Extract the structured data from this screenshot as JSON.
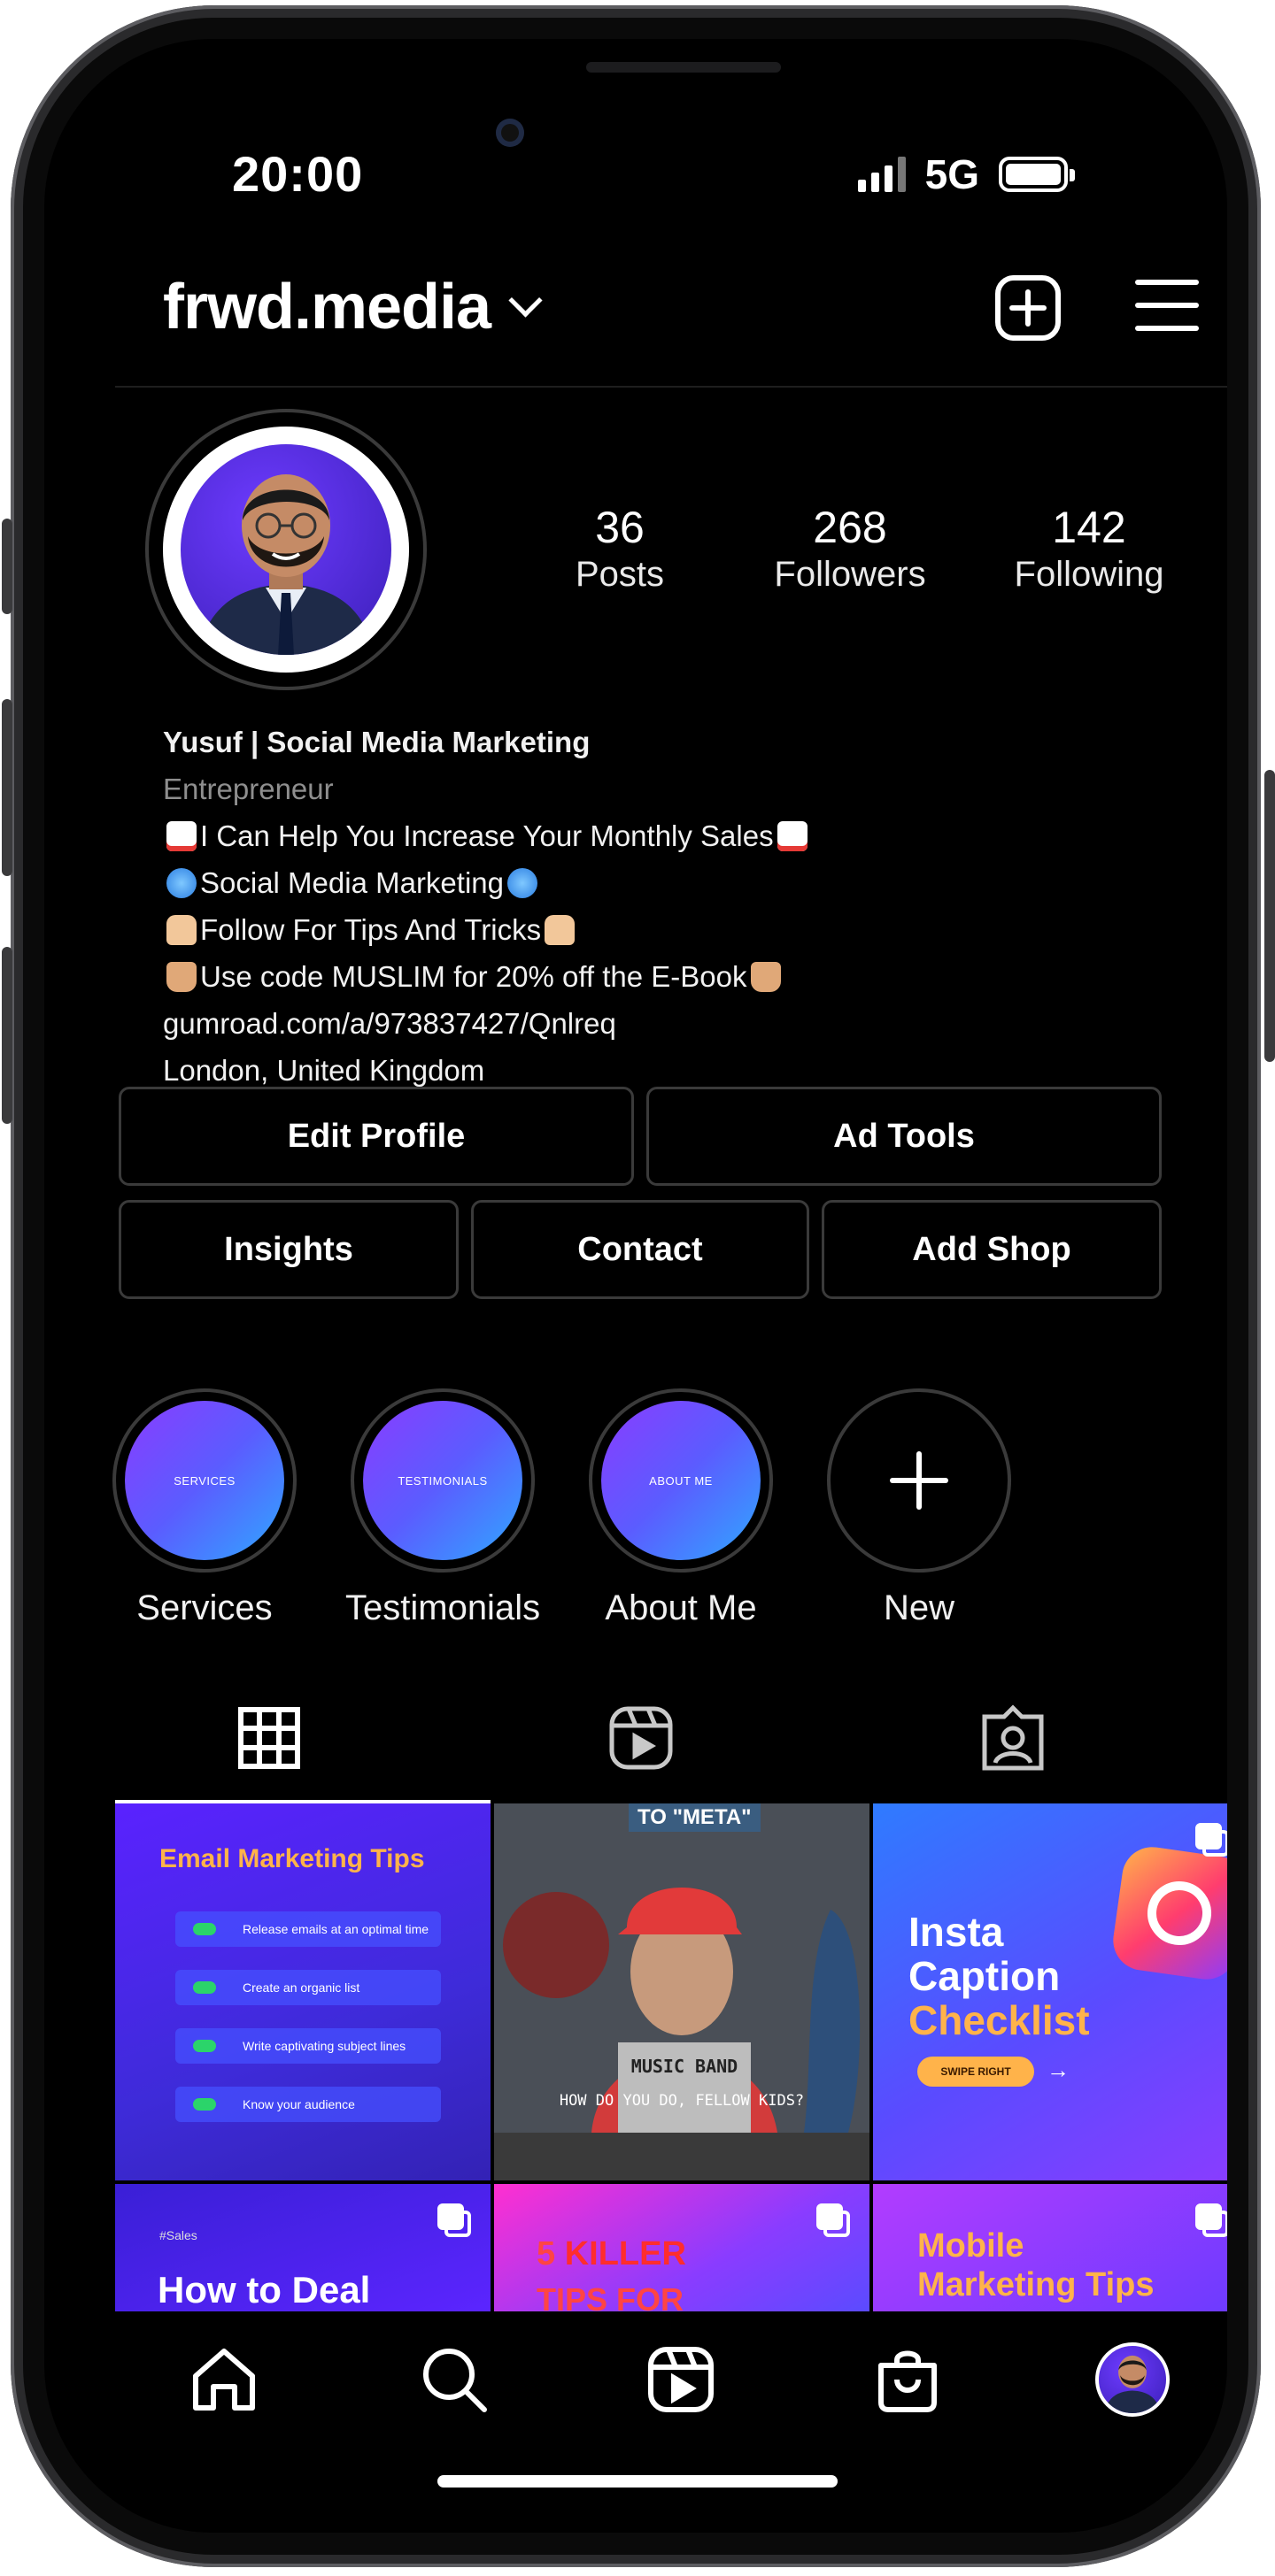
{
  "status_bar": {
    "time": "20:00",
    "network": "5G"
  },
  "header": {
    "username": "frwd.media"
  },
  "profile": {
    "stats": [
      {
        "value": "36",
        "label": "Posts"
      },
      {
        "value": "268",
        "label": "Followers"
      },
      {
        "value": "142",
        "label": "Following"
      }
    ],
    "bio": {
      "name": "Yusuf | Social Media Marketing",
      "category": "Entrepreneur",
      "line1": "I Can Help You Increase Your Monthly Sales",
      "line2": "Social Media Marketing",
      "line3": "Follow For Tips And Tricks",
      "line4": "Use code MUSLIM for 20% off the E-Book",
      "link": "gumroad.com/a/973837427/Qnlreq",
      "location": "London, United Kingdom"
    }
  },
  "buttons": {
    "edit_profile": "Edit Profile",
    "ad_tools": "Ad Tools",
    "insights": "Insights",
    "contact": "Contact",
    "add_shop": "Add Shop"
  },
  "highlights": [
    {
      "cover": "SERVICES",
      "label": "Services"
    },
    {
      "cover": "TESTIMONIALS",
      "label": "Testimonials"
    },
    {
      "cover": "ABOUT ME",
      "label": "About Me"
    },
    {
      "cover": "",
      "label": "New"
    }
  ],
  "tabs": [
    "grid-icon",
    "reels-icon",
    "tagged-icon"
  ],
  "posts": {
    "p1": {
      "title": "Email Marketing Tips",
      "items": [
        "Release emails at an optimal time",
        "Create an organic list",
        "Write captivating subject lines",
        "Know your audience"
      ]
    },
    "p2": {
      "top": "TO \"META\"",
      "shirt": "MUSIC BAND",
      "caption": "HOW DO YOU DO, FELLOW KIDS?"
    },
    "p3": {
      "line1": "Insta",
      "line2": "Caption",
      "line3": "Checklist",
      "cta": "SWIPE RIGHT"
    },
    "p4": {
      "tag": "#Sales",
      "title": "How to Deal"
    },
    "p5": {
      "num": "5",
      "word": "KILLER",
      "line2": "TIPS FOR"
    },
    "p6": {
      "line1": "Mobile",
      "line2": "Marketing Tips"
    }
  },
  "nav": [
    "home-icon",
    "search-icon",
    "reels-icon",
    "shop-icon",
    "profile-avatar"
  ],
  "colors": {
    "accent_purple": "#5b25ff",
    "accent_orange": "#ffb34a",
    "background": "#000000"
  }
}
